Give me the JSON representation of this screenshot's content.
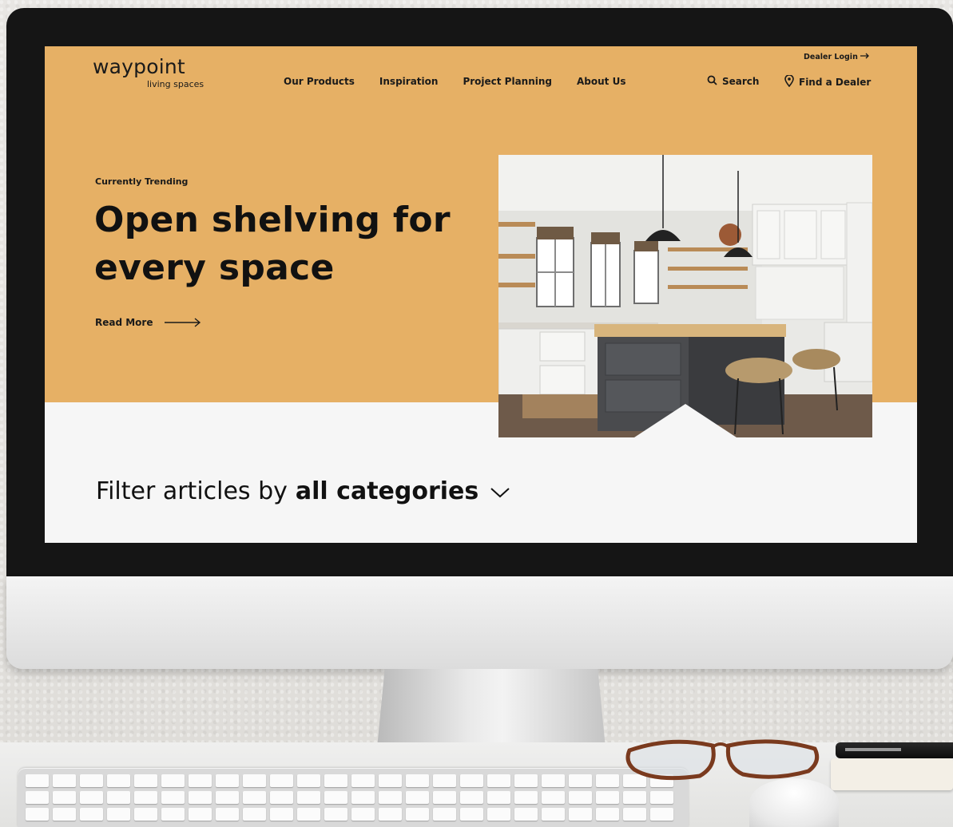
{
  "brand": {
    "name": "waypoint",
    "tagline": "living spaces"
  },
  "header": {
    "nav": [
      "Our Products",
      "Inspiration",
      "Project Planning",
      "About Us"
    ],
    "dealer_login": "Dealer Login",
    "search_label": "Search",
    "find_dealer_label": "Find a Dealer"
  },
  "hero": {
    "eyebrow": "Currently Trending",
    "headline_line1": "Open shelving for",
    "headline_line2": "every space",
    "cta": "Read More",
    "image_alt": "kitchen-with-open-shelving-photo"
  },
  "filter": {
    "prefix": "Filter articles by",
    "category": "all categories"
  },
  "colors": {
    "hero_bg": "#e6b065",
    "text": "#111111",
    "page_bg": "#f6f6f6",
    "bezel": "#151515"
  },
  "icons": [
    "search-icon",
    "location-pin-icon",
    "arrow-right-icon",
    "chevron-down-icon"
  ]
}
